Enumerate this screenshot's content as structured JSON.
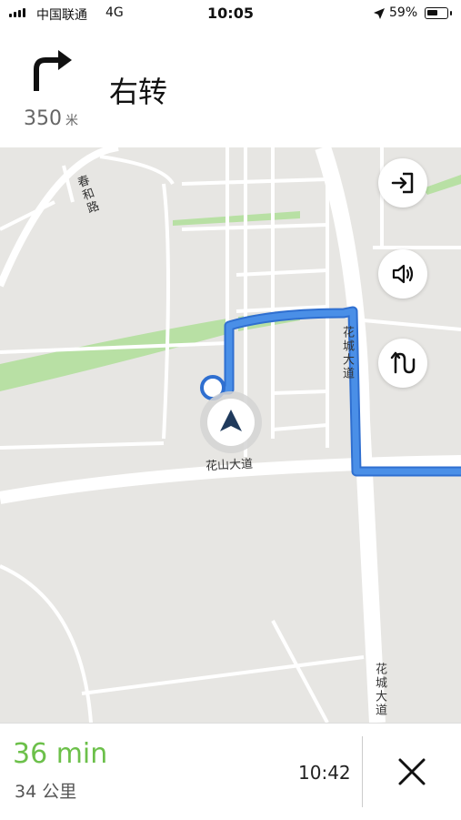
{
  "status_bar": {
    "carrier": "中国联通",
    "network": "4G",
    "time": "10:05",
    "battery_percent": "59%",
    "battery_level": 0.59,
    "location_icon": "location-arrow-icon",
    "signal_icon": "signal-bars-icon"
  },
  "navigation": {
    "maneuver_icon": "turn-right-arrow-icon",
    "distance_value": "350",
    "distance_unit": "米",
    "instruction": "右转"
  },
  "map": {
    "road_labels": {
      "chunhe_road": "春和路",
      "huashan_avenue": "花山大道",
      "huacheng_avenue_upper": "花城大道",
      "huacheng_avenue_lower": "花城大道"
    },
    "buttons": [
      "exit-icon",
      "volume-icon",
      "route-options-icon"
    ],
    "colors": {
      "route": "#4a8fe7",
      "map_background": "#e7e6e3",
      "green_area": "#b8e0a4",
      "road": "#ffffff"
    }
  },
  "trip": {
    "duration": "36 min",
    "distance": "34 公里",
    "arrival_time": "10:42",
    "close_icon": "close-icon",
    "accent_color": "#6cc04a"
  }
}
